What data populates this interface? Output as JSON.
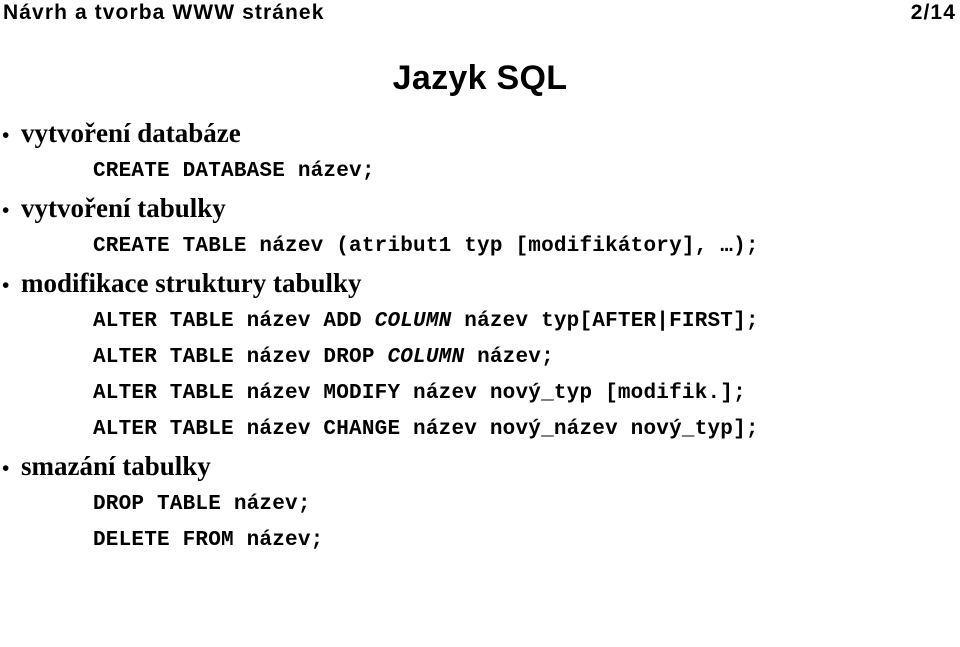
{
  "header": {
    "course_title": "Návrh a tvorba WWW stránek",
    "page_indicator": "2/14"
  },
  "slide": {
    "title": "Jazyk SQL",
    "sections": [
      {
        "bullet_char": "•",
        "bullet_label": "vytvoření databáze",
        "code_lines": [
          {
            "pre": "CREATE DATABASE název;",
            "italic": "",
            "post": ""
          }
        ]
      },
      {
        "bullet_char": "•",
        "bullet_label": "vytvoření tabulky",
        "code_lines": [
          {
            "pre": "CREATE TABLE název (atribut1 typ [modifikátory], …);",
            "italic": "",
            "post": ""
          }
        ]
      },
      {
        "bullet_char": "•",
        "bullet_label": "modifikace struktury tabulky",
        "code_lines": [
          {
            "pre": "ALTER TABLE název ADD ",
            "italic": "COLUMN",
            "post": " název typ[AFTER|FIRST];"
          },
          {
            "pre": "ALTER TABLE název DROP ",
            "italic": "COLUMN",
            "post": " název;"
          },
          {
            "pre": "ALTER TABLE název MODIFY název nový_typ [modifik.];",
            "italic": "",
            "post": ""
          },
          {
            "pre": "ALTER TABLE název CHANGE název nový_název nový_typ];",
            "italic": "",
            "post": ""
          }
        ]
      },
      {
        "bullet_char": "•",
        "bullet_label": "smazání tabulky",
        "code_lines": [
          {
            "pre": "DROP TABLE název;",
            "italic": "",
            "post": ""
          },
          {
            "pre": "DELETE FROM název;",
            "italic": "",
            "post": ""
          }
        ]
      }
    ]
  },
  "colors": {
    "text": "#000000",
    "background": "#ffffff"
  }
}
